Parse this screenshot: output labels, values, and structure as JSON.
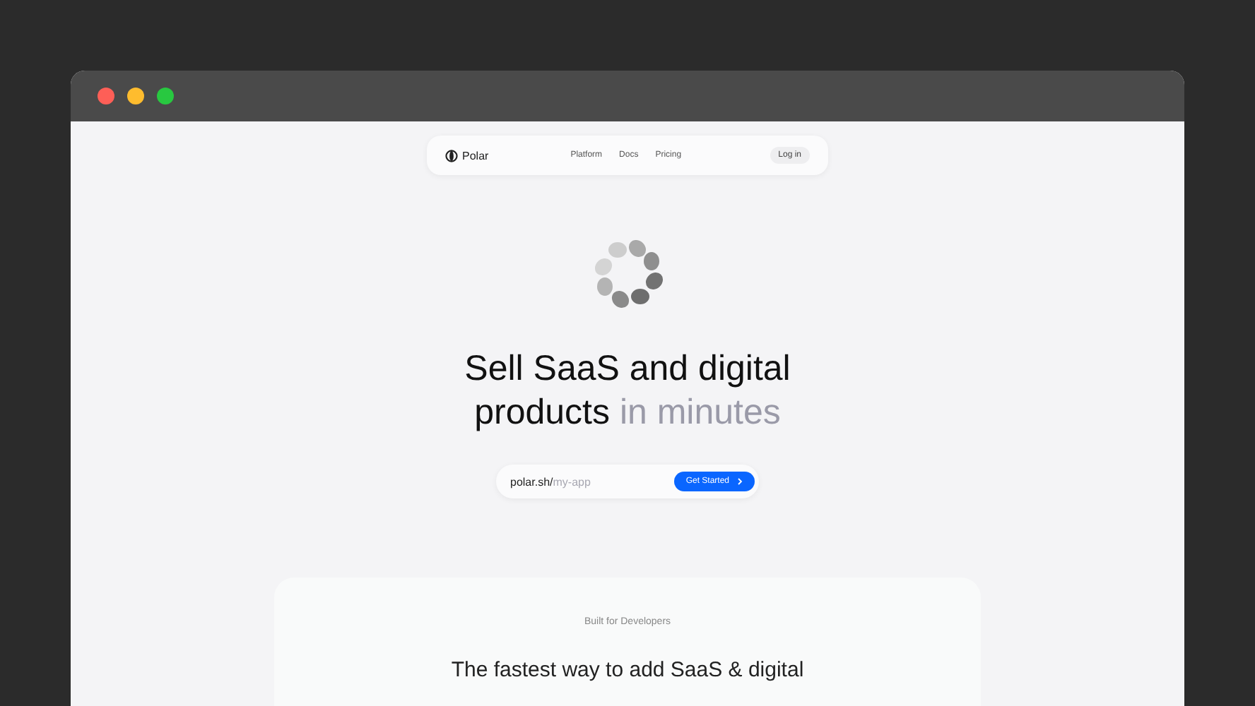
{
  "nav": {
    "brand": "Polar",
    "links": [
      "Platform",
      "Docs",
      "Pricing"
    ],
    "login": "Log in"
  },
  "hero": {
    "headline": "Sell SaaS and digital products",
    "highlight": "in minutes",
    "url_prefix": "polar.sh/",
    "placeholder": "my-app",
    "cta": "Get Started"
  },
  "section": {
    "eyebrow": "Built for Developers",
    "title": "The fastest way to add SaaS & digital"
  }
}
